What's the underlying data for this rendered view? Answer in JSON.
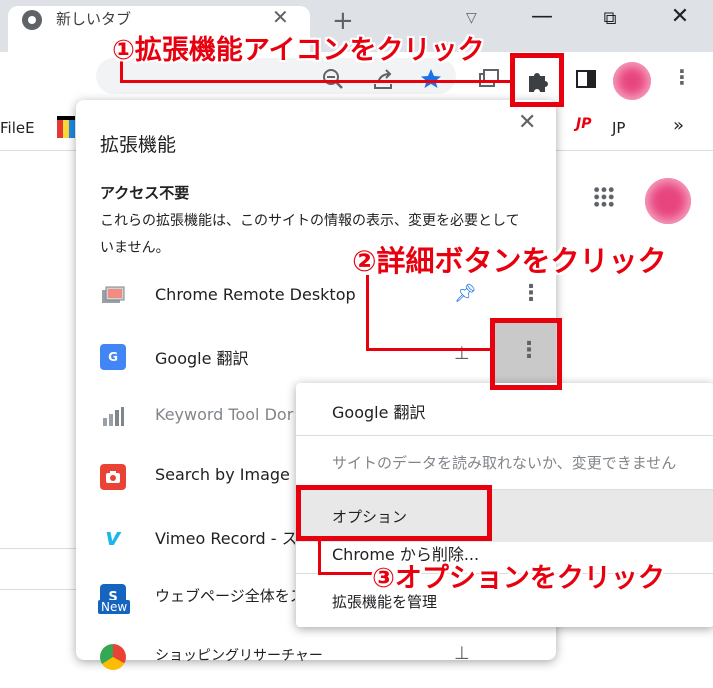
{
  "browser": {
    "tab_title": "新しいタブ",
    "tab_close": "✕",
    "new_tab": "+",
    "win_minimize": "—",
    "win_maximize": "⧉",
    "win_close": "✕",
    "bookmarks": [
      {
        "label": "FileE"
      },
      {
        "label": "JP"
      }
    ],
    "bookmarks_more": "»"
  },
  "icons": {
    "zoom": "zoom-out-icon",
    "share": "share-icon",
    "bookmark_star": "star-icon",
    "extensions": "puzzle-icon",
    "side_panel": "side-panel-icon",
    "menu": "more-vert-icon"
  },
  "extensions_popup": {
    "title": "拡張機能",
    "close": "✕",
    "section_heading": "アクセス不要",
    "section_description": "これらの拡張機能は、このサイトの情報の表示、変更を必要としていません。",
    "items": [
      {
        "name": "Chrome Remote Desktop",
        "pinned": true,
        "dimmed": false
      },
      {
        "name": "Google 翻訳",
        "pinned": false,
        "dimmed": false
      },
      {
        "name": "Keyword Tool Dor",
        "pinned": false,
        "dimmed": true
      },
      {
        "name": "Search by Image",
        "pinned": false,
        "dimmed": false
      },
      {
        "name": "Vimeo Record - ス",
        "pinned": false,
        "dimmed": false
      },
      {
        "name": "ウェブページ全体をス",
        "pinned": false,
        "dimmed": false
      },
      {
        "name": "ショッピングリサーチャー",
        "pinned": false,
        "dimmed": false
      }
    ],
    "new_badge": "New"
  },
  "context_menu": {
    "items": [
      {
        "label": "Google 翻訳",
        "disabled": false
      },
      {
        "label": "サイトのデータを読み取れないか、変更できません",
        "disabled": true
      },
      {
        "label": "オプション",
        "disabled": false,
        "highlighted": true
      },
      {
        "label": "Chrome から削除...",
        "disabled": false
      },
      {
        "label": "拡張機能を管理",
        "disabled": false
      }
    ]
  },
  "annotations": {
    "step1": "①拡張機能アイコンをクリック",
    "step2": "②詳細ボタンをクリック",
    "step3": "③オプションをクリック"
  },
  "colors": {
    "annotation_red": "#e8000f",
    "pin_blue": "#1a73e8",
    "star_blue": "#1a73e8"
  }
}
